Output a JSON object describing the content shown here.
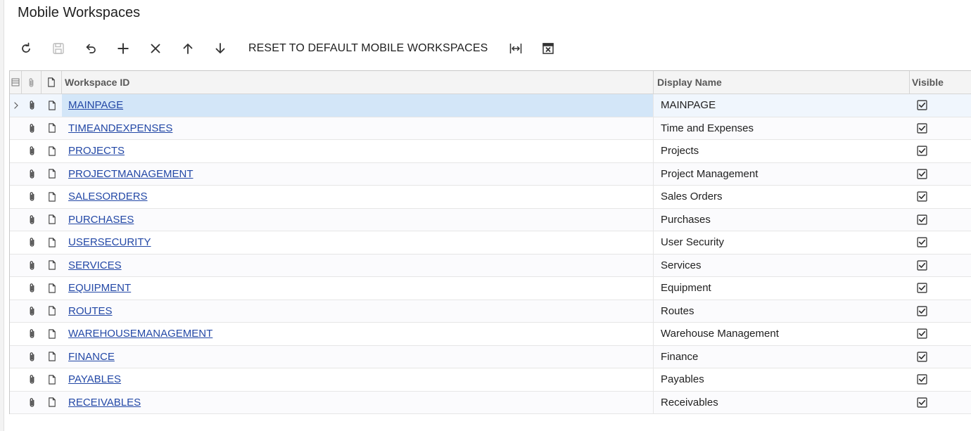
{
  "page": {
    "title": "Mobile Workspaces"
  },
  "toolbar": {
    "buttons": [
      {
        "icon": "refresh-icon",
        "disabled": false
      },
      {
        "icon": "save-icon",
        "disabled": true
      },
      {
        "icon": "undo-icon",
        "disabled": false
      },
      {
        "icon": "add-icon",
        "disabled": false
      },
      {
        "icon": "delete-icon",
        "disabled": false
      },
      {
        "icon": "move-up-icon",
        "disabled": false
      },
      {
        "icon": "move-down-icon",
        "disabled": false
      }
    ],
    "reset_label": "RESET TO DEFAULT MOBILE WORKSPACES",
    "fit_icon": "fit-columns-icon",
    "export_icon": "export-excel-icon"
  },
  "grid": {
    "columns": {
      "workspace_id": "Workspace ID",
      "display_name": "Display Name",
      "visible": "Visible"
    },
    "rows": [
      {
        "id": "MAINPAGE",
        "name": "MAINPAGE",
        "visible": true
      },
      {
        "id": "TIMEANDEXPENSES",
        "name": "Time and Expenses",
        "visible": true
      },
      {
        "id": "PROJECTS",
        "name": "Projects",
        "visible": true
      },
      {
        "id": "PROJECTMANAGEMENT",
        "name": "Project Management",
        "visible": true
      },
      {
        "id": "SALESORDERS",
        "name": "Sales Orders",
        "visible": true
      },
      {
        "id": "PURCHASES",
        "name": "Purchases",
        "visible": true
      },
      {
        "id": "USERSECURITY",
        "name": "User Security",
        "visible": true
      },
      {
        "id": "SERVICES",
        "name": "Services",
        "visible": true
      },
      {
        "id": "EQUIPMENT",
        "name": "Equipment",
        "visible": true
      },
      {
        "id": "ROUTES",
        "name": "Routes",
        "visible": true
      },
      {
        "id": "WAREHOUSEMANAGEMENT",
        "name": "Warehouse Management",
        "visible": true
      },
      {
        "id": "FINANCE",
        "name": "Finance",
        "visible": true
      },
      {
        "id": "PAYABLES",
        "name": "Payables",
        "visible": true
      },
      {
        "id": "RECEIVABLES",
        "name": "Receivables",
        "visible": true
      }
    ]
  }
}
